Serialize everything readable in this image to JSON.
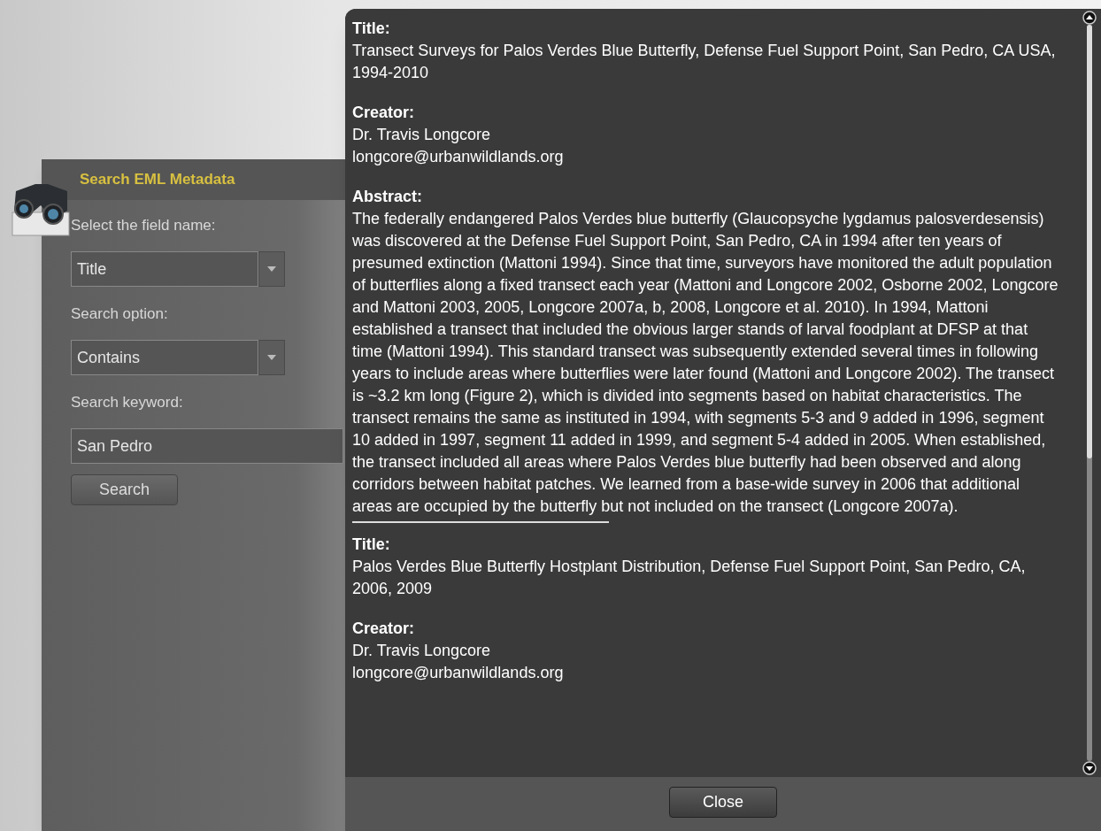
{
  "search_panel": {
    "title": "Search EML Metadata",
    "fields": [
      {
        "kind": "dropdown",
        "label": "Select the field name:",
        "value": "Title"
      },
      {
        "kind": "dropdown",
        "label": "Search option:",
        "value": "Contains"
      },
      {
        "kind": "text",
        "label": "Search keyword:",
        "value": "San Pedro"
      }
    ],
    "search_button": "Search"
  },
  "results_dialog": {
    "records": [
      {
        "title_label": "Title:",
        "title": "Transect Surveys for Palos Verdes Blue Butterfly, Defense Fuel Support Point, San Pedro, CA USA, 1994-2010",
        "creator_label": "Creator:",
        "creator_lines": [
          "Dr. Travis Longcore",
          "longcore@urbanwildlands.org"
        ],
        "abstract_label": "Abstract:",
        "abstract": "The federally endangered Palos Verdes blue butterfly (Glaucopsyche lygdamus palosverdesensis) was discovered at the Defense Fuel Support Point, San Pedro, CA in 1994 after ten years of presumed extinction (Mattoni 1994). Since that time, surveyors have monitored the adult population of butterflies along a fixed transect each year (Mattoni and Longcore 2002, Osborne 2002, Longcore and Mattoni 2003, 2005, Longcore 2007a, b, 2008, Longcore et al. 2010). In 1994, Mattoni established a transect that included the obvious larger stands of larval foodplant at DFSP at that time (Mattoni 1994). This standard transect was subsequently extended several times in following years to include areas where butterflies were later found (Mattoni and Longcore 2002). The transect is ~3.2 km long (Figure 2), which is divided into segments based on habitat characteristics. The transect remains the same as instituted in 1994, with segments 5-3 and 9 added in 1996, segment 10 added in 1997, segment 11 added in 1999, and segment 5-4 added in 2005. When established, the transect included all areas where Palos Verdes blue butterfly had been observed and along corridors between habitat patches. We learned from a base-wide survey in 2006 that additional areas are occupied by the butterfly but not included on the transect (Longcore 2007a)."
      },
      {
        "title_label": "Title:",
        "title": "Palos Verdes Blue Butterfly Hostplant Distribution, Defense Fuel Support Point, San Pedro, CA, 2006, 2009",
        "creator_label": "Creator:",
        "creator_lines": [
          "Dr. Travis Longcore",
          "longcore@urbanwildlands.org"
        ]
      }
    ],
    "close_button": "Close"
  }
}
